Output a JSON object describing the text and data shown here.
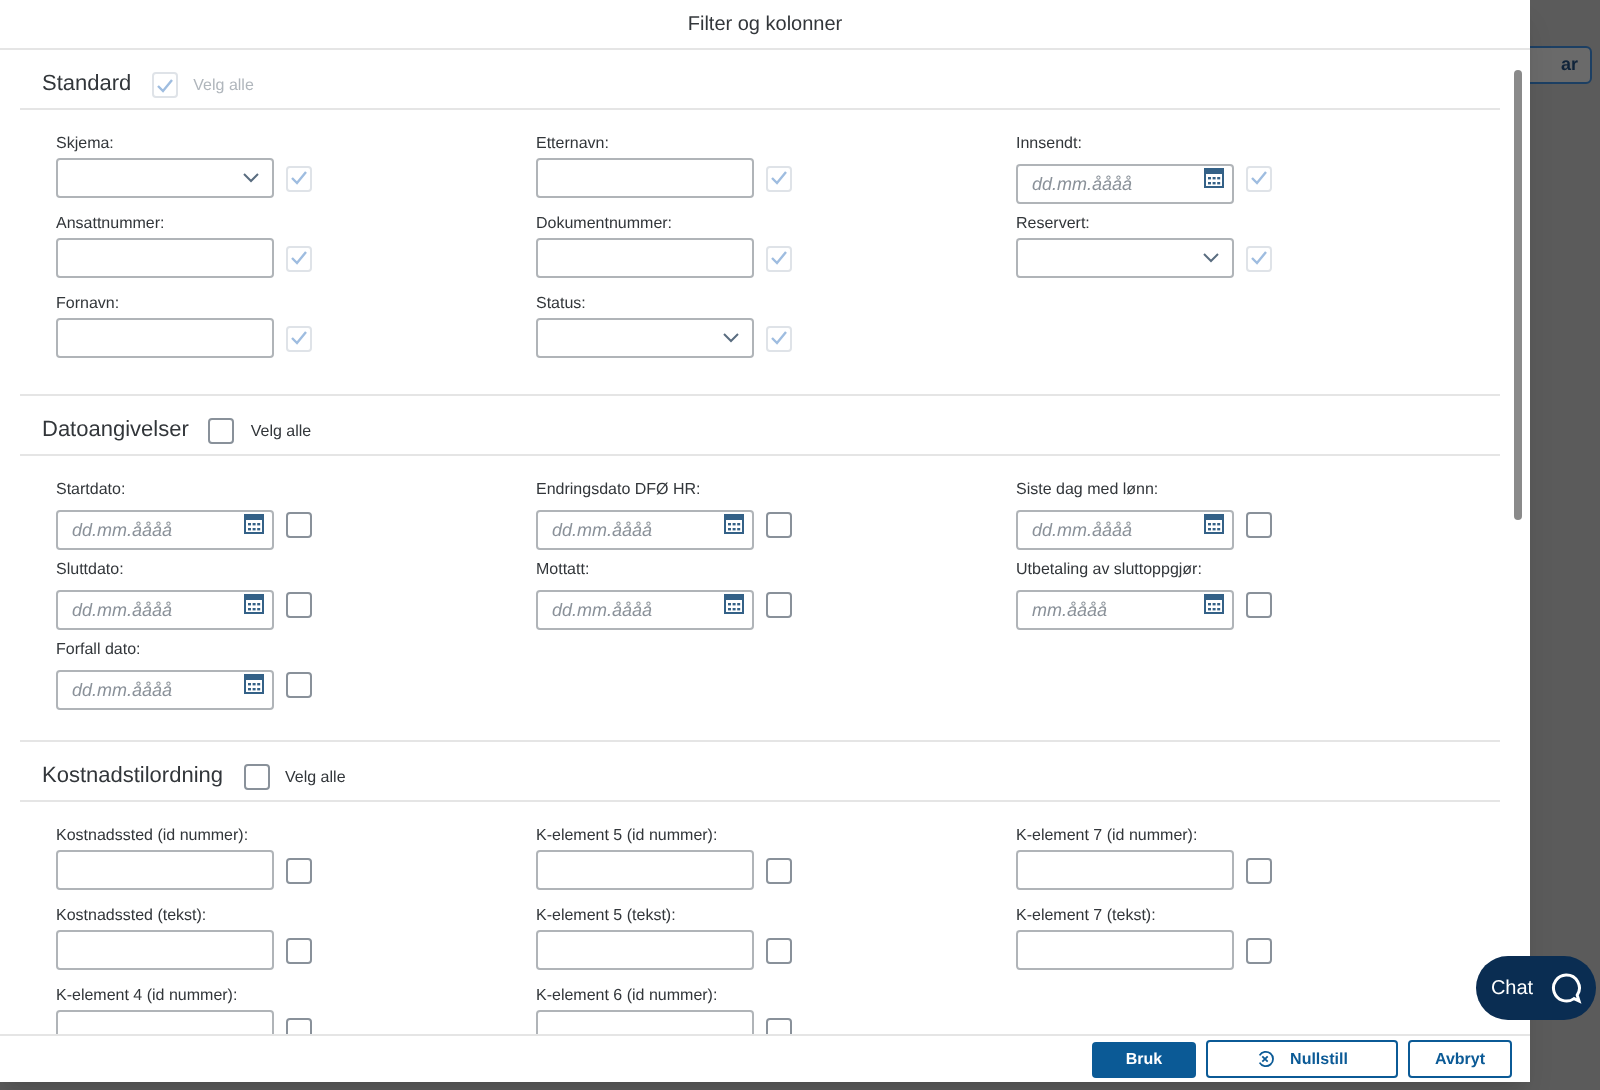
{
  "dialog": {
    "title": "Filter og kolonner"
  },
  "backdrop_button": "ar",
  "sections": [
    {
      "title": "Standard",
      "disabled": true,
      "select_all": {
        "label": "Velg alle",
        "checked": true
      },
      "fields": [
        {
          "label": "Skjema:",
          "kind": "select",
          "checked": true
        },
        {
          "label": "Etternavn:",
          "kind": "text",
          "checked": true
        },
        {
          "label": "Innsendt:",
          "kind": "date",
          "placeholder": "dd.mm.åååå",
          "checked": true
        },
        {
          "label": "Ansattnummer:",
          "kind": "text",
          "checked": true
        },
        {
          "label": "Dokumentnummer:",
          "kind": "text",
          "checked": true
        },
        {
          "label": "Reservert:",
          "kind": "select",
          "checked": true
        },
        {
          "label": "Fornavn:",
          "kind": "text",
          "checked": true
        },
        {
          "label": "Status:",
          "kind": "select",
          "checked": true
        }
      ]
    },
    {
      "title": "Datoangivelser",
      "disabled": false,
      "select_all": {
        "label": "Velg alle",
        "checked": false
      },
      "fields": [
        {
          "label": "Startdato:",
          "kind": "date",
          "placeholder": "dd.mm.åååå",
          "checked": false
        },
        {
          "label": "Endringsdato DFØ HR:",
          "kind": "date",
          "placeholder": "dd.mm.åååå",
          "checked": false
        },
        {
          "label": "Siste dag med lønn:",
          "kind": "date",
          "placeholder": "dd.mm.åååå",
          "checked": false
        },
        {
          "label": "Sluttdato:",
          "kind": "date",
          "placeholder": "dd.mm.åååå",
          "checked": false
        },
        {
          "label": "Mottatt:",
          "kind": "date",
          "placeholder": "dd.mm.åååå",
          "checked": false
        },
        {
          "label": "Utbetaling av sluttoppgjør:",
          "kind": "date",
          "placeholder": "mm.åååå",
          "checked": false
        },
        {
          "label": "Forfall dato:",
          "kind": "date",
          "placeholder": "dd.mm.åååå",
          "checked": false
        }
      ]
    },
    {
      "title": "Kostnadstilordning",
      "disabled": false,
      "select_all": {
        "label": "Velg alle",
        "checked": false
      },
      "fields": [
        {
          "label": "Kostnadssted (id nummer):",
          "kind": "text",
          "checked": false
        },
        {
          "label": "K-element 5 (id nummer):",
          "kind": "text",
          "checked": false
        },
        {
          "label": "K-element 7 (id nummer):",
          "kind": "text",
          "checked": false
        },
        {
          "label": "Kostnadssted (tekst):",
          "kind": "text",
          "checked": false
        },
        {
          "label": "K-element 5 (tekst):",
          "kind": "text",
          "checked": false
        },
        {
          "label": "K-element 7 (tekst):",
          "kind": "text",
          "checked": false
        },
        {
          "label": "K-element 4 (id nummer):",
          "kind": "text",
          "checked": false
        },
        {
          "label": "K-element 6 (id nummer):",
          "kind": "text",
          "checked": false
        }
      ]
    }
  ],
  "footer_buttons": [
    {
      "label": "Bruk",
      "kind": "primary"
    },
    {
      "label": "Nullstill",
      "kind": "reset"
    },
    {
      "label": "Avbryt",
      "kind": "secondary"
    }
  ],
  "chat": {
    "label": "Chat"
  }
}
